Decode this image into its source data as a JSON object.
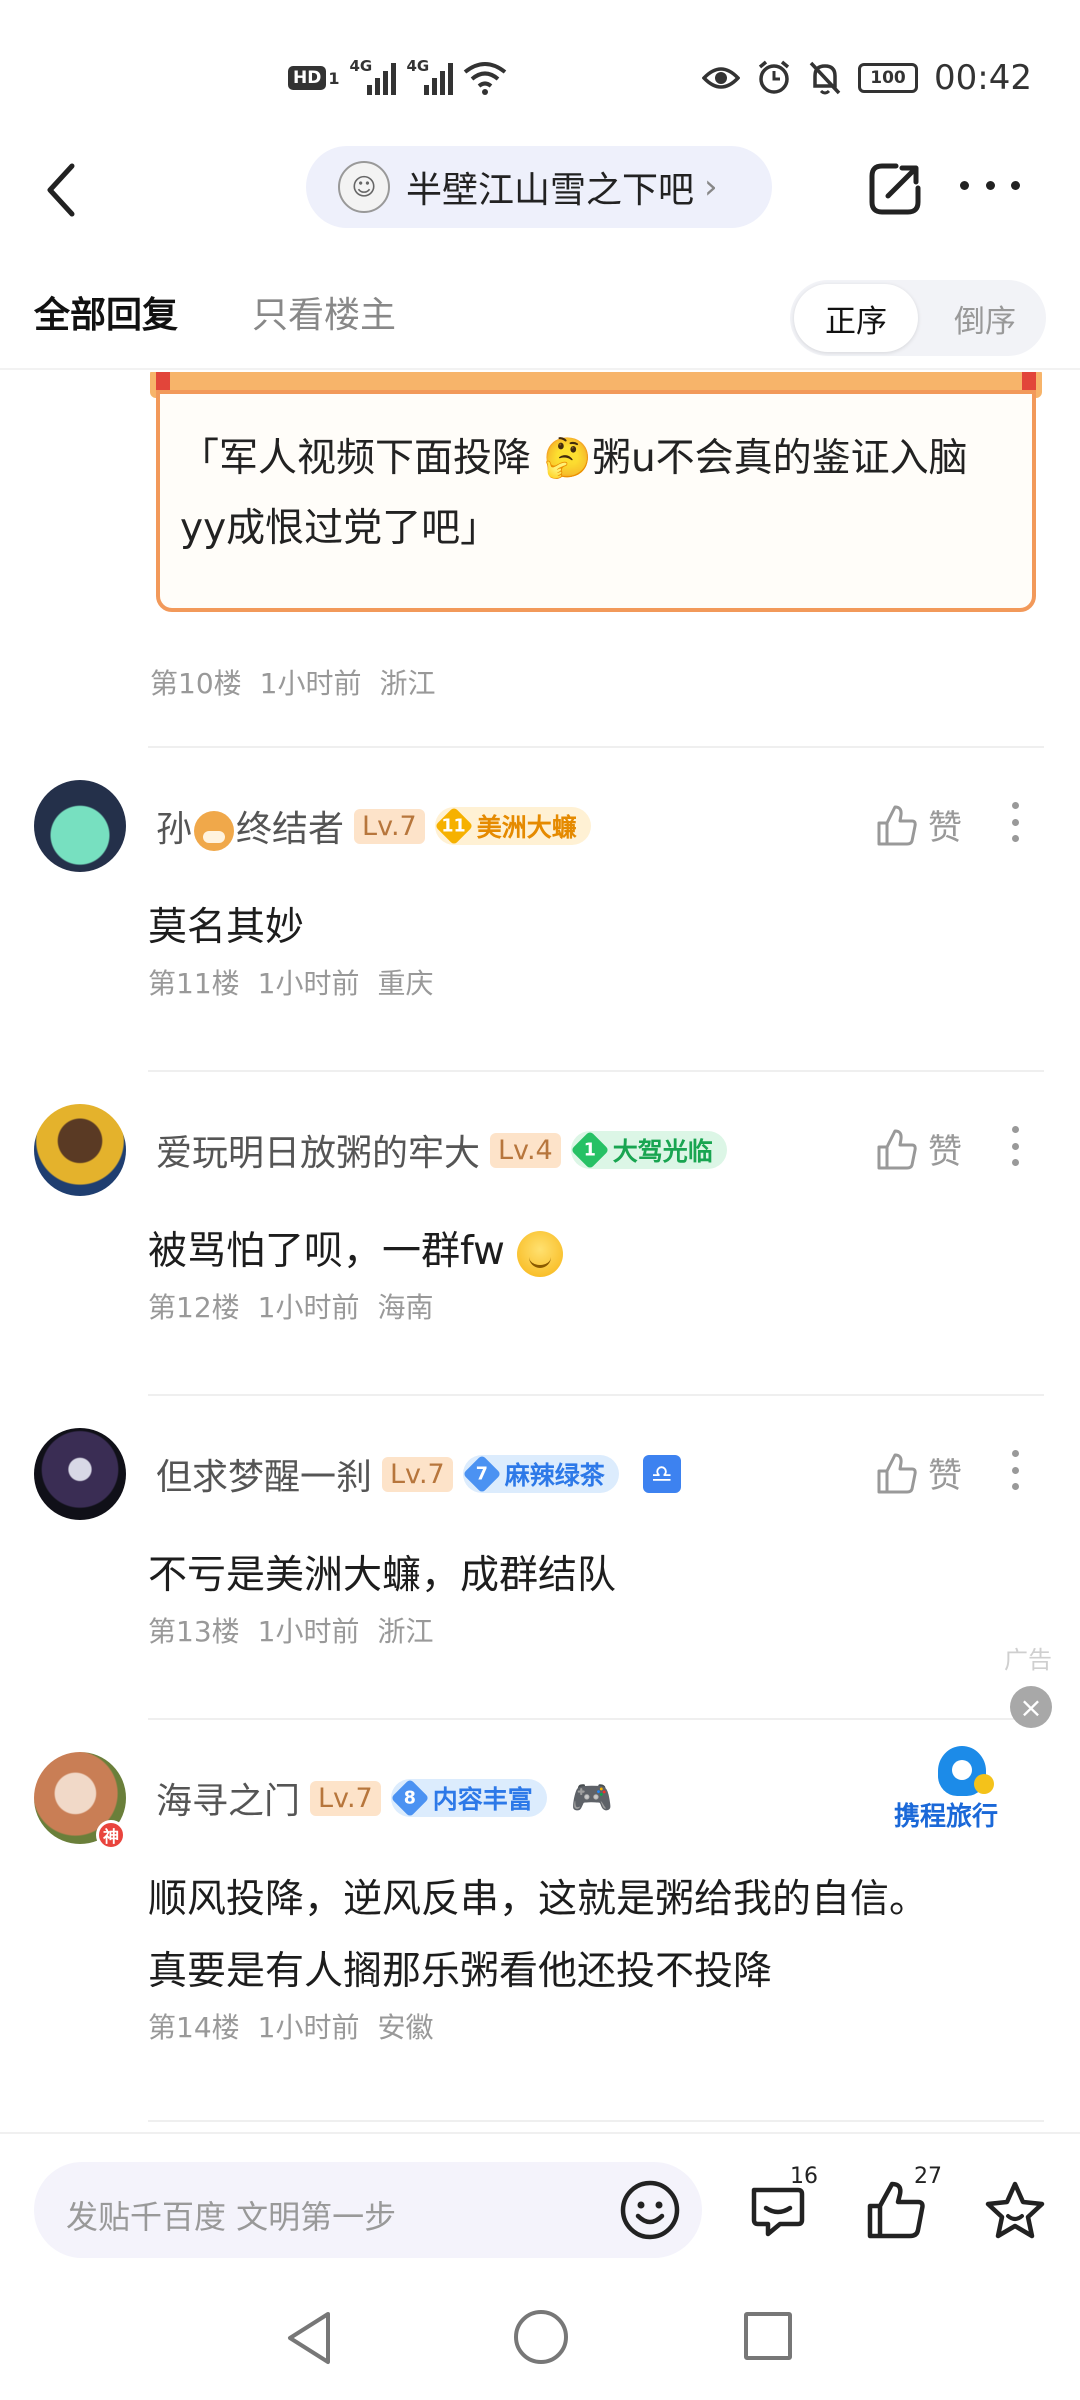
{
  "status_bar": {
    "hd": "HD",
    "sim1": "1",
    "net1": "4G",
    "net2": "4G",
    "battery": "100",
    "time": "00:42"
  },
  "nav": {
    "forum_name": "半壁江山雪之下吧",
    "forum_arrow": "›"
  },
  "tabs": {
    "all": "全部回复",
    "owner_only": "只看楼主",
    "order_asc": "正序",
    "order_desc": "倒序"
  },
  "quoted": {
    "text": "「军人视频下面投降 🤔粥u不会真的鉴证入脑yy成恨过党了吧」",
    "floor": "第10楼",
    "time": "1小时前",
    "location": "浙江"
  },
  "like_label": "赞",
  "posts": [
    {
      "username_prefix": "孙",
      "username_suffix": "终结者",
      "level": "Lv.7",
      "badge_level": "11",
      "badge_text": "美洲大蠊",
      "text": "莫名其妙",
      "floor": "第11楼",
      "time": "1小时前",
      "location": "重庆"
    },
    {
      "username": "爱玩明日放粥的牢大",
      "level": "Lv.4",
      "badge_level": "1",
      "badge_text": "大驾光临",
      "text": "被骂怕了呗，一群fw",
      "floor": "第12楼",
      "time": "1小时前",
      "location": "海南"
    },
    {
      "username": "但求梦醒一刹",
      "level": "Lv.7",
      "badge_level": "7",
      "badge_text": "麻辣绿茶",
      "zodiac": "♎",
      "text": "不亏是美洲大蠊，成群结队",
      "floor": "第13楼",
      "time": "1小时前",
      "location": "浙江"
    },
    {
      "username": "海寻之门",
      "god_badge": "神",
      "level": "Lv.7",
      "badge_level": "8",
      "badge_text": "内容丰富",
      "text_line1": "顺风投降，逆风反串，这就是粥给我的自信。",
      "text_line2": "真要是有人搁那乐粥看他还投不投降",
      "floor": "第14楼",
      "time": "1小时前",
      "location": "安徽"
    }
  ],
  "ad": {
    "label": "广告",
    "close": "×",
    "brand": "携程旅行"
  },
  "bottom_bar": {
    "input_placeholder": "发贴千百度 文明第一步",
    "comment_count": "16",
    "like_count": "27"
  },
  "colors": {
    "accent_orange": "#f2995a",
    "tag_gold": "#e58a00",
    "tag_green": "#19a551",
    "tag_blue": "#2d79e8",
    "text_secondary": "#999999"
  }
}
